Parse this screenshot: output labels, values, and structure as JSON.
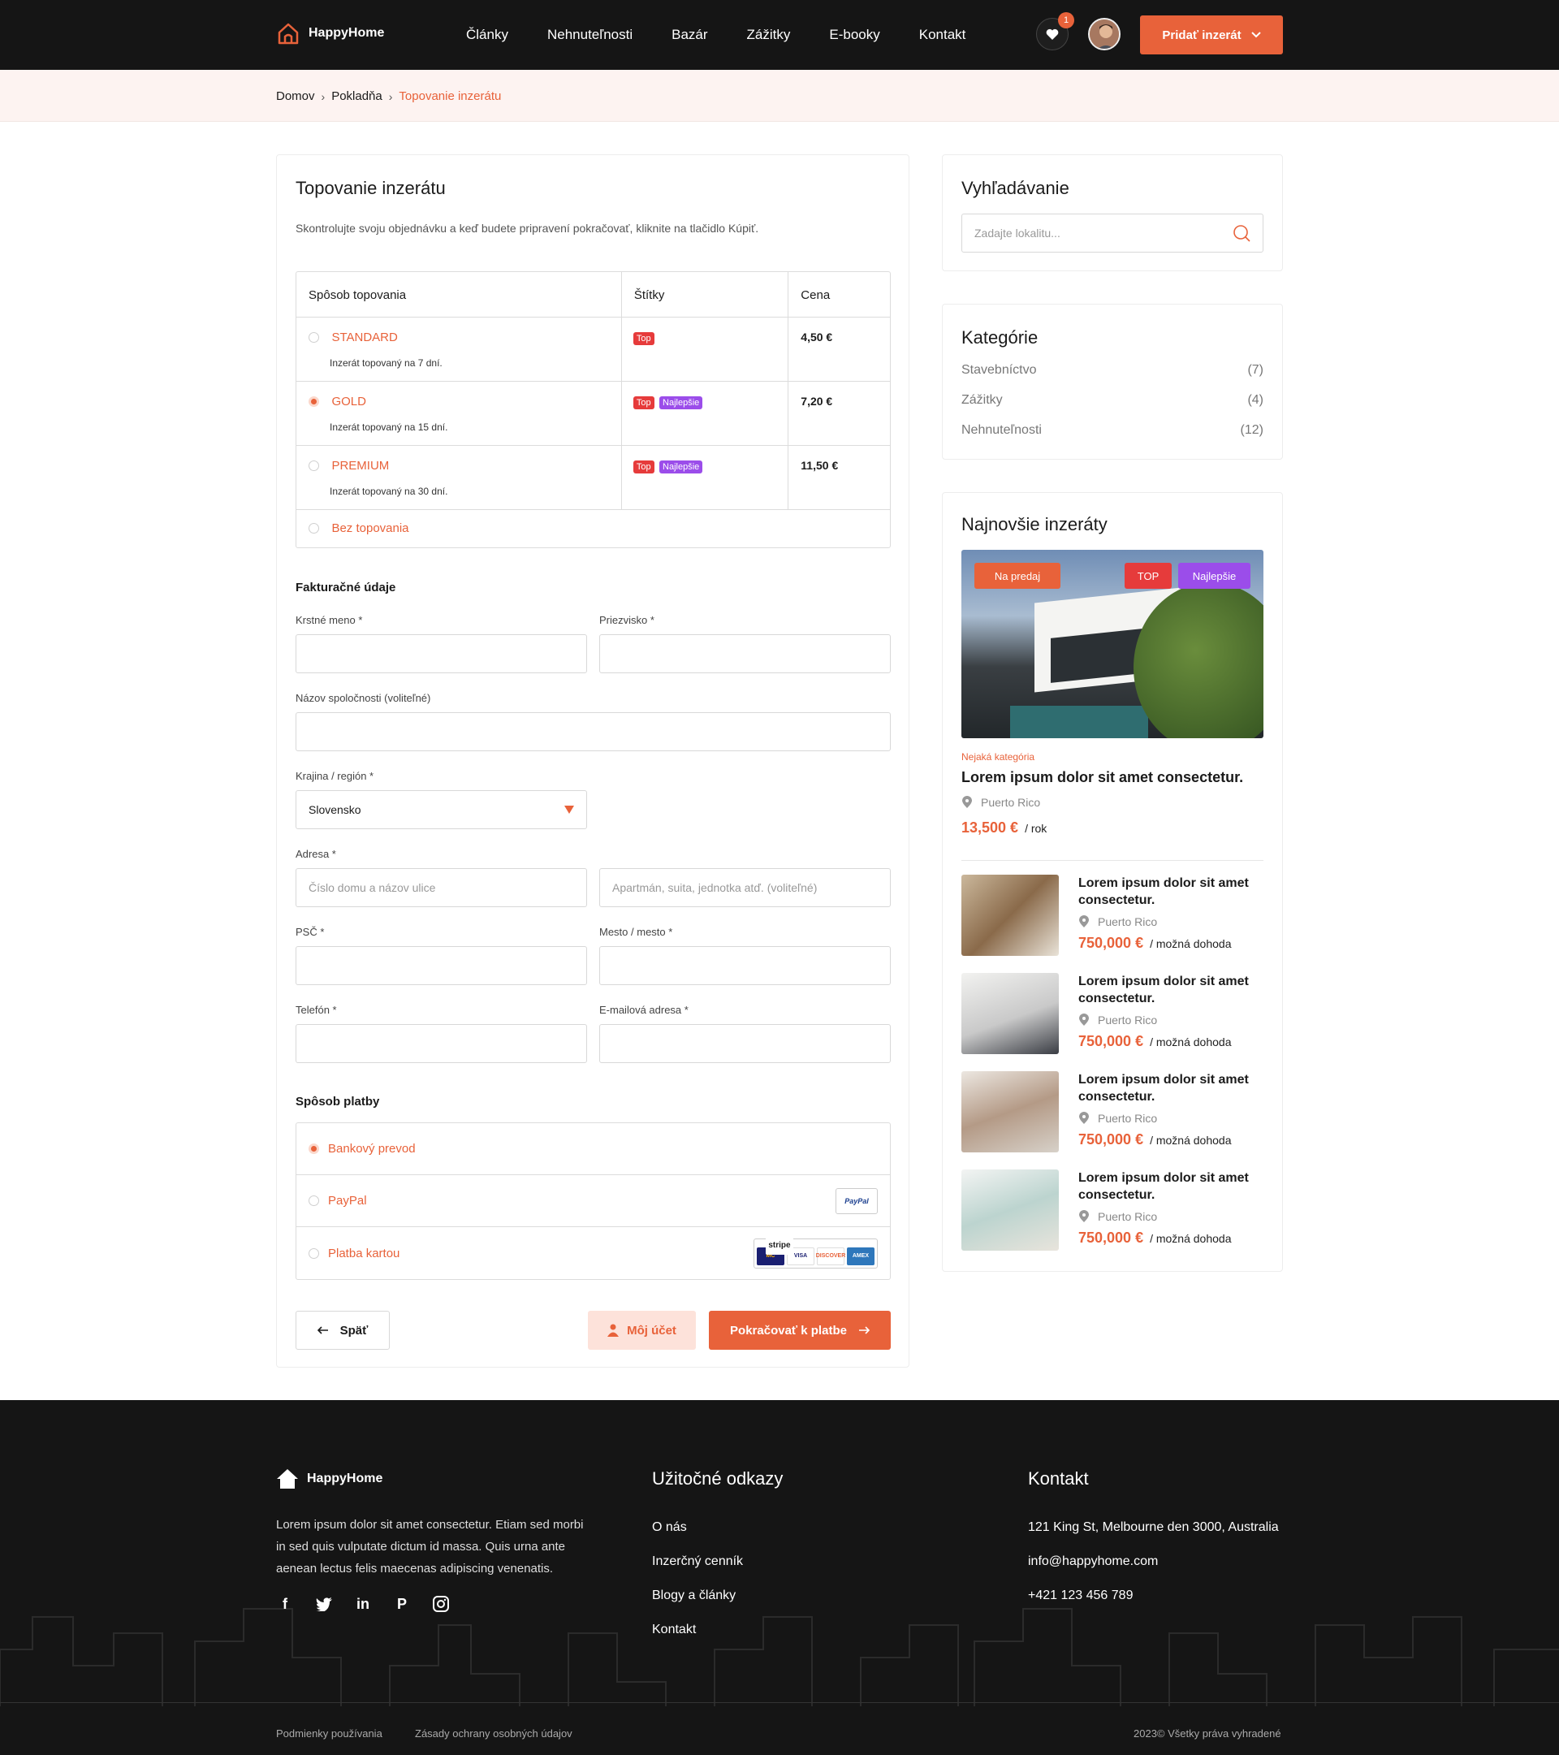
{
  "header": {
    "logo": "HappyHome",
    "nav": [
      "Články",
      "Nehnuteľnosti",
      "Bazár",
      "Zážitky",
      "E-booky",
      "Kontakt"
    ],
    "favorites_count": "1",
    "add_button": "Pridať inzerát"
  },
  "breadcrumb": {
    "home": "Domov",
    "checkout": "Pokladňa",
    "current": "Topovanie inzerátu"
  },
  "main": {
    "title": "Topovanie inzerátu",
    "intro": "Skontrolujte svoju objednávku a keď budete pripravení pokračovať, kliknite na tlačidlo Kúpiť.",
    "table": {
      "headers": [
        "Spôsob topovania",
        "Štítky",
        "Cena"
      ],
      "options": [
        {
          "name": "STANDARD",
          "desc": "Inzerát topovaný na 7 dní.",
          "tags": [
            "Top"
          ],
          "price": "4,50 €",
          "selected": false
        },
        {
          "name": "GOLD",
          "desc": "Inzerát topovaný na 15 dní.",
          "tags": [
            "Top",
            "Najlepšie"
          ],
          "price": "7,20 €",
          "selected": true
        },
        {
          "name": "PREMIUM",
          "desc": "Inzerát topovaný na 30 dní.",
          "tags": [
            "Top",
            "Najlepšie"
          ],
          "price": "11,50 €",
          "selected": false
        }
      ],
      "none_option": "Bez topovania"
    },
    "billing": {
      "title": "Fakturačné údaje",
      "first_name": "Krstné meno *",
      "last_name": "Priezvisko *",
      "company": "Názov spoločnosti (voliteľné)",
      "country_label": "Krajina / región *",
      "country_value": "Slovensko",
      "address_label": "Adresa *",
      "address_placeholder": "Číslo domu a názov ulice",
      "address2_placeholder": "Apartmán, suita, jednotka atď. (voliteľné)",
      "zip": "PSČ *",
      "city": "Mesto / mesto *",
      "phone": "Telefón *",
      "email": "E-mailová adresa *"
    },
    "payment": {
      "title": "Spôsob platby",
      "methods": [
        "Bankový prevod",
        "PayPal",
        "Platba kartou"
      ],
      "paypal_logo": "PayPal",
      "stripe_label": "stripe",
      "cards": [
        "MC",
        "VISA",
        "DISCOVER",
        "AMEX"
      ]
    },
    "buttons": {
      "back": "Späť",
      "account": "Môj účet",
      "continue": "Pokračovať k platbe"
    }
  },
  "sidebar": {
    "search": {
      "title": "Vyhľadávanie",
      "placeholder": "Zadajte lokalitu..."
    },
    "categories": {
      "title": "Kategórie",
      "items": [
        {
          "name": "Stavebníctvo",
          "count": "(7)"
        },
        {
          "name": "Zážitky",
          "count": "(4)"
        },
        {
          "name": "Nehnuteľnosti",
          "count": "(12)"
        }
      ]
    },
    "latest": {
      "title": "Najnovšie inzeráty",
      "featured": {
        "badge_sale": "Na predaj",
        "badge_top": "TOP",
        "badge_best": "Najlepšie",
        "category": "Nejaká kategória",
        "title": "Lorem ipsum dolor sit amet consectetur.",
        "location": "Puerto Rico",
        "price": "13,500 €",
        "price_note": "/ rok"
      },
      "items": [
        {
          "title": "Lorem ipsum dolor sit amet consectetur.",
          "location": "Puerto Rico",
          "price": "750,000 €",
          "price_note": "/ možná dohoda"
        },
        {
          "title": "Lorem ipsum dolor sit amet consectetur.",
          "location": "Puerto Rico",
          "price": "750,000 €",
          "price_note": "/ možná dohoda"
        },
        {
          "title": "Lorem ipsum dolor sit amet consectetur.",
          "location": "Puerto Rico",
          "price": "750,000 €",
          "price_note": "/ možná dohoda"
        },
        {
          "title": "Lorem ipsum dolor sit amet consectetur.",
          "location": "Puerto Rico",
          "price": "750,000 €",
          "price_note": "/ možná dohoda"
        }
      ]
    }
  },
  "footer": {
    "logo": "HappyHome",
    "text": "Lorem ipsum dolor sit amet consectetur. Etiam sed morbi in sed quis vulputate dictum id massa. Quis urna ante aenean lectus felis maecenas adipiscing venenatis.",
    "social": [
      "facebook-icon",
      "twitter-icon",
      "linkedin-icon",
      "pinterest-icon",
      "instagram-icon"
    ],
    "links_title": "Užitočné odkazy",
    "links": [
      "O nás",
      "Inzerčný cenník",
      "Blogy a články",
      "Kontakt"
    ],
    "contact_title": "Kontakt",
    "contact": [
      "121 King St, Melbourne den 3000, Australia",
      "info@happyhome.com",
      "+421 123 456 789"
    ],
    "terms": "Podmienky používania",
    "privacy": "Zásady ochrany osobných údajov",
    "copyright": "2023© Všetky práva vyhradené"
  },
  "colors": {
    "accent": "#e8623a",
    "dark": "#151515",
    "tag_red": "#e63b3b",
    "tag_purple": "#9b4dea"
  }
}
